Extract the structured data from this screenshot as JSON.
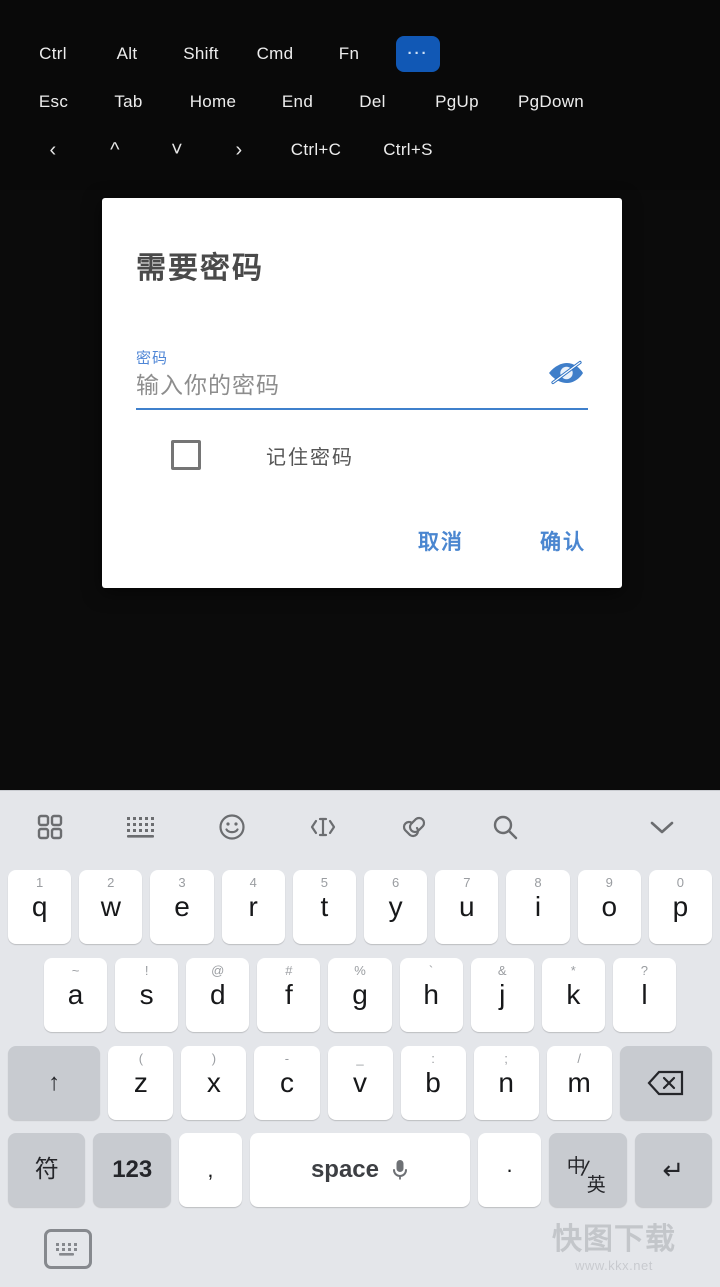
{
  "top_toolbar": {
    "row1": [
      {
        "label": "Ctrl",
        "name": "key-ctrl",
        "accent": false
      },
      {
        "label": "Alt",
        "name": "key-alt",
        "accent": false
      },
      {
        "label": "Shift",
        "name": "key-shift",
        "accent": false
      },
      {
        "label": "Cmd",
        "name": "key-cmd",
        "accent": false
      },
      {
        "label": "Fn",
        "name": "key-fn",
        "accent": false
      },
      {
        "label": "···",
        "name": "key-more",
        "accent": true
      }
    ],
    "row2": [
      {
        "label": "Esc",
        "name": "key-esc"
      },
      {
        "label": "Tab",
        "name": "key-tab"
      },
      {
        "label": "Home",
        "name": "key-home"
      },
      {
        "label": "End",
        "name": "key-end"
      },
      {
        "label": "Del",
        "name": "key-del"
      },
      {
        "label": "PgUp",
        "name": "key-pgup"
      },
      {
        "label": "PgDown",
        "name": "key-pgdown"
      }
    ],
    "row3": [
      {
        "label": "‹",
        "name": "key-arrow-left"
      },
      {
        "label": "^",
        "name": "key-arrow-up"
      },
      {
        "label": "˅",
        "name": "key-arrow-down"
      },
      {
        "label": "›",
        "name": "key-arrow-right"
      },
      {
        "label": "Ctrl+C",
        "name": "key-ctrl-c"
      },
      {
        "label": "Ctrl+S",
        "name": "key-ctrl-s"
      }
    ],
    "accent_color": "#1158b5"
  },
  "dialog": {
    "title": "需要密码",
    "password_label": "密码",
    "password_value": "",
    "password_placeholder": "输入你的密码",
    "visibility_icon": "eye-off-icon",
    "remember_label": "记住密码",
    "remember_checked": false,
    "cancel_label": "取消",
    "confirm_label": "确认",
    "accent_color": "#4a86d0",
    "underline_color": "#3f80cc"
  },
  "keyboard": {
    "toolbar": [
      {
        "name": "apps-grid-icon",
        "label": "apps-grid-icon"
      },
      {
        "name": "keyboard-icon",
        "label": "keyboard-icon"
      },
      {
        "name": "emoji-icon",
        "label": "emoji-icon"
      },
      {
        "name": "cursor-move-icon",
        "label": "cursor-move-icon"
      },
      {
        "name": "clipboard-link-icon",
        "label": "clipboard-link-icon"
      },
      {
        "name": "search-icon",
        "label": "search-icon"
      },
      {
        "name": "chevron-down-icon",
        "label": "chevron-down-icon"
      }
    ],
    "row1": [
      {
        "letter": "q",
        "alt": "1"
      },
      {
        "letter": "w",
        "alt": "2"
      },
      {
        "letter": "e",
        "alt": "3"
      },
      {
        "letter": "r",
        "alt": "4"
      },
      {
        "letter": "t",
        "alt": "5"
      },
      {
        "letter": "y",
        "alt": "6"
      },
      {
        "letter": "u",
        "alt": "7"
      },
      {
        "letter": "i",
        "alt": "8"
      },
      {
        "letter": "o",
        "alt": "9"
      },
      {
        "letter": "p",
        "alt": "0"
      }
    ],
    "row2": [
      {
        "letter": "a",
        "alt": "~"
      },
      {
        "letter": "s",
        "alt": "!"
      },
      {
        "letter": "d",
        "alt": "@"
      },
      {
        "letter": "f",
        "alt": "#"
      },
      {
        "letter": "g",
        "alt": "%"
      },
      {
        "letter": "h",
        "alt": "`"
      },
      {
        "letter": "j",
        "alt": "&"
      },
      {
        "letter": "k",
        "alt": "*"
      },
      {
        "letter": "l",
        "alt": "?"
      }
    ],
    "row3": [
      {
        "letter": "z",
        "alt": "("
      },
      {
        "letter": "x",
        "alt": ")"
      },
      {
        "letter": "c",
        "alt": "-"
      },
      {
        "letter": "v",
        "alt": "_"
      },
      {
        "letter": "b",
        "alt": ":"
      },
      {
        "letter": "n",
        "alt": ";"
      },
      {
        "letter": "m",
        "alt": "/"
      }
    ],
    "shift_label": "↑",
    "backspace_label": "backspace-icon",
    "row4": {
      "symbol_label": "符",
      "num_label": "123",
      "comma_label": ",",
      "space_label": "space",
      "mic_label": "mic-icon",
      "period_label": "·",
      "lang_top": "中",
      "lang_bottom": "英",
      "enter_label": "↵"
    },
    "bottom_bar": {
      "ime_switch": "keyboard-switch-icon"
    },
    "key_bg": "#ffffff",
    "fn_key_bg": "#c8cbd0",
    "keyboard_bg": "#e4e6ea"
  },
  "watermark": {
    "text": "快图下载",
    "url": "www.kkx.net"
  }
}
